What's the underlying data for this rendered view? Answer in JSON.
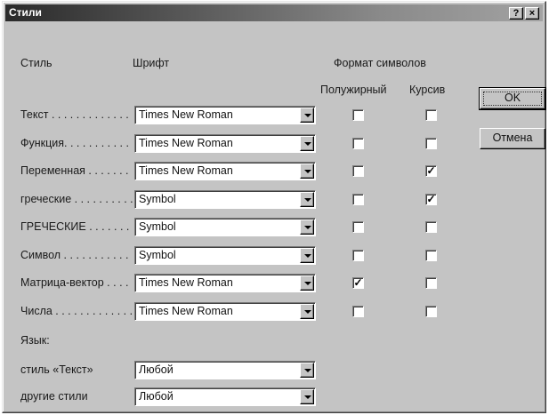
{
  "window": {
    "title": "Стили",
    "help_button": "?",
    "close_button": "×"
  },
  "headers": {
    "style": "Стиль",
    "font": "Шрифт",
    "format": "Формат символов",
    "bold": "Полужирный",
    "italic": "Курсив"
  },
  "buttons": {
    "ok": "OK",
    "cancel": "Отмена"
  },
  "rows": [
    {
      "label": "Текст . . . . . . . . . . . . . . . . . . . . .",
      "font": "Times New Roman",
      "bold": false,
      "italic": false
    },
    {
      "label": "Функция. . . . . . . . . . . . . . . . . . . .",
      "font": "Times New Roman",
      "bold": false,
      "italic": false
    },
    {
      "label": "Переменная . . . . . . . . . . . . . . . . .",
      "font": "Times New Roman",
      "bold": false,
      "italic": true
    },
    {
      "label": "греческие . . . . . . . . . . . . . . . . . . .",
      "font": "Symbol",
      "bold": false,
      "italic": true
    },
    {
      "label": "ГРЕЧЕСКИЕ . . . . . . . . . . . . . . . . . .",
      "font": "Symbol",
      "bold": false,
      "italic": false
    },
    {
      "label": "Символ . . . . . . . . . . . . . . . . . . . . .",
      "font": "Symbol",
      "bold": false,
      "italic": false
    },
    {
      "label": "Матрица-вектор . . . . . . . . . . . . . .",
      "font": "Times New Roman",
      "bold": true,
      "italic": false
    },
    {
      "label": "Числа . . . . . . . . . . . . . . . . . . . . . .",
      "font": "Times New Roman",
      "bold": false,
      "italic": false
    }
  ],
  "language": {
    "heading": "Язык:",
    "text_style_label": "стиль «Текст»",
    "text_style_value": "Любой",
    "other_styles_label": "другие стили",
    "other_styles_value": "Любой"
  },
  "check_mark": "✓"
}
